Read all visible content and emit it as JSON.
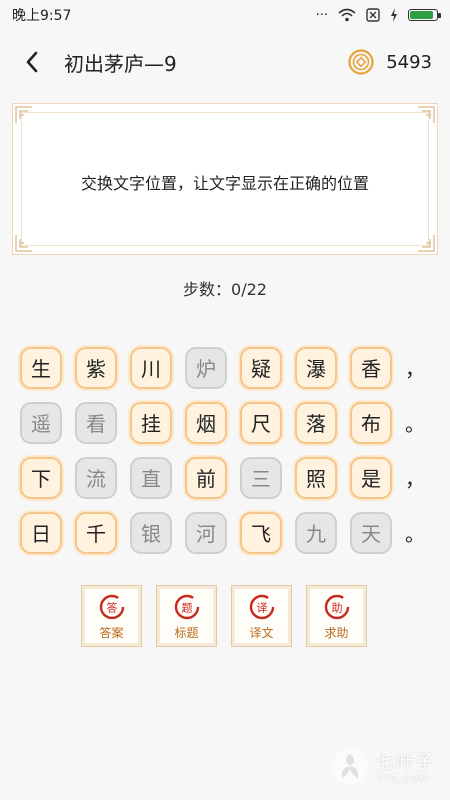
{
  "status_bar": {
    "time": "晚上9:57",
    "battery_level": 0.9
  },
  "header": {
    "title": "初出茅庐—9",
    "coins": "5493"
  },
  "instruction": "交换文字位置，让文字显示在正确的位置",
  "steps": "步数：0/22",
  "grid": [
    {
      "tiles": [
        {
          "char": "生",
          "state": "active"
        },
        {
          "char": "紫",
          "state": "active"
        },
        {
          "char": "川",
          "state": "active"
        },
        {
          "char": "炉",
          "state": "fixed"
        },
        {
          "char": "疑",
          "state": "active"
        },
        {
          "char": "瀑",
          "state": "active"
        },
        {
          "char": "香",
          "state": "active"
        }
      ],
      "punct": "，"
    },
    {
      "tiles": [
        {
          "char": "遥",
          "state": "fixed"
        },
        {
          "char": "看",
          "state": "fixed"
        },
        {
          "char": "挂",
          "state": "active"
        },
        {
          "char": "烟",
          "state": "active"
        },
        {
          "char": "尺",
          "state": "active"
        },
        {
          "char": "落",
          "state": "active"
        },
        {
          "char": "布",
          "state": "active"
        }
      ],
      "punct": "。"
    },
    {
      "tiles": [
        {
          "char": "下",
          "state": "active"
        },
        {
          "char": "流",
          "state": "fixed"
        },
        {
          "char": "直",
          "state": "fixed"
        },
        {
          "char": "前",
          "state": "active"
        },
        {
          "char": "三",
          "state": "fixed"
        },
        {
          "char": "照",
          "state": "active"
        },
        {
          "char": "是",
          "state": "active"
        }
      ],
      "punct": "，"
    },
    {
      "tiles": [
        {
          "char": "日",
          "state": "active"
        },
        {
          "char": "千",
          "state": "active"
        },
        {
          "char": "银",
          "state": "fixed"
        },
        {
          "char": "河",
          "state": "fixed"
        },
        {
          "char": "飞",
          "state": "active"
        },
        {
          "char": "九",
          "state": "fixed"
        },
        {
          "char": "天",
          "state": "fixed"
        }
      ],
      "punct": "。"
    }
  ],
  "actions": [
    {
      "seal": "答",
      "label": "答案"
    },
    {
      "seal": "题",
      "label": "标题"
    },
    {
      "seal": "译",
      "label": "译文"
    },
    {
      "seal": "助",
      "label": "求助"
    }
  ],
  "watermark": {
    "brand": "七叶子",
    "domain": "7YZ.COM"
  },
  "colors": {
    "accent": "#b86a1e",
    "tile_border": "#f5c58a",
    "seal_red": "#c8281e",
    "coin_gold": "#e8a33c"
  }
}
